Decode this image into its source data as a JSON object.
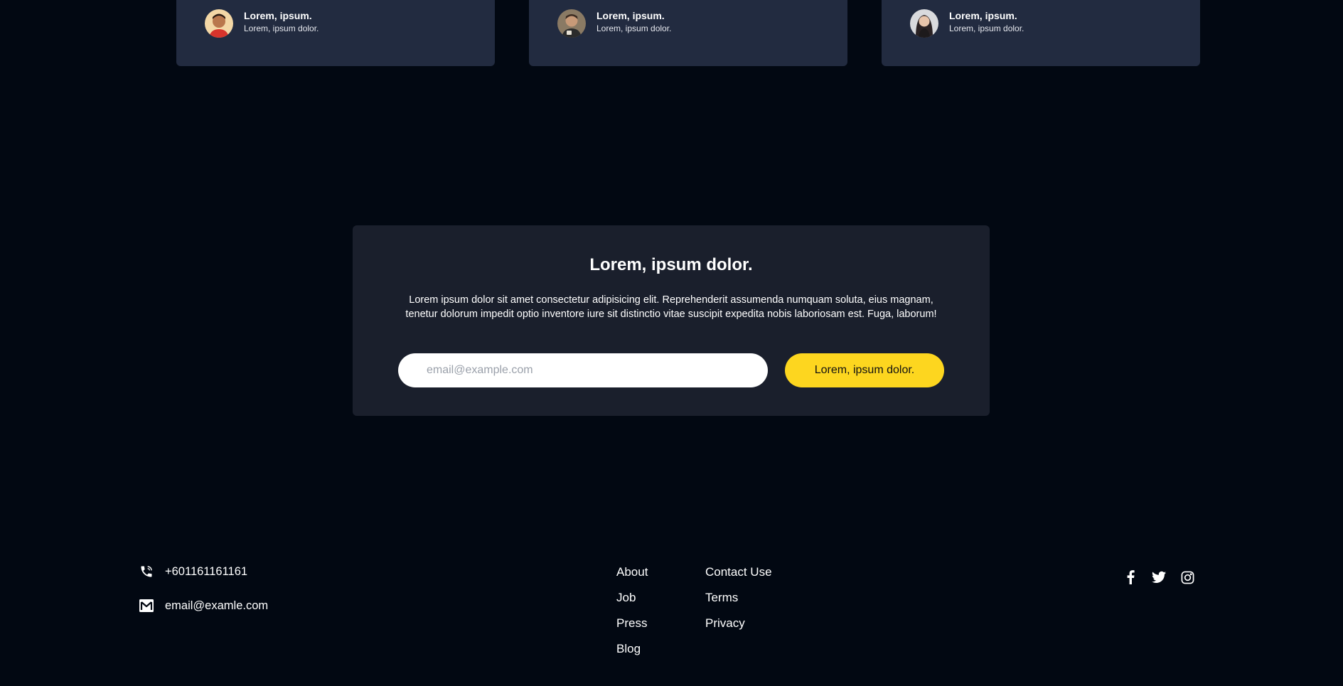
{
  "testimonials": [
    {
      "name": "Lorem, ipsum.",
      "role": "Lorem, ipsum dolor."
    },
    {
      "name": "Lorem, ipsum.",
      "role": "Lorem, ipsum dolor."
    },
    {
      "name": "Lorem, ipsum.",
      "role": "Lorem, ipsum dolor."
    }
  ],
  "newsletter": {
    "title": "Lorem, ipsum dolor.",
    "text": "Lorem ipsum dolor sit amet consectetur adipisicing elit. Reprehenderit assumenda numquam soluta, eius magnam, tenetur dolorum impedit optio inventore iure sit distinctio vitae suscipit expedita nobis laboriosam est. Fuga, laborum!",
    "email_placeholder": "email@example.com",
    "button_label": "Lorem, ipsum dolor."
  },
  "footer": {
    "phone": "+601161161161",
    "email": "email@examle.com",
    "links_col1": [
      "About",
      "Job",
      "Press",
      "Blog"
    ],
    "links_col2": [
      "Contact Use",
      "Terms",
      "Privacy"
    ],
    "social_icons": [
      "facebook-icon",
      "twitter-icon",
      "instagram-icon"
    ]
  },
  "colors": {
    "background": "#020812",
    "card": "#222b40",
    "newsletter_panel": "#1a1f2c",
    "accent_yellow": "#fdd61f"
  }
}
